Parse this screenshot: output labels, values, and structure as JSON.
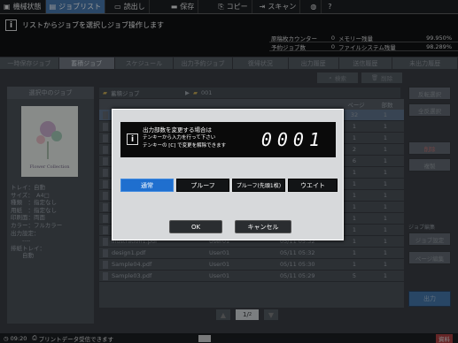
{
  "topbar": {
    "tabs": [
      {
        "label": "機械状態",
        "icon": "machine-icon"
      },
      {
        "label": "ジョブリスト",
        "icon": "job-list-icon"
      },
      {
        "label": "読出し",
        "icon": "recall-icon"
      },
      {
        "label": "保存",
        "icon": "save-icon"
      },
      {
        "label": "コピー",
        "icon": "copy-icon"
      },
      {
        "label": "スキャン",
        "icon": "scan-icon"
      }
    ]
  },
  "message": {
    "text": "リストからジョブを選択しジョブ操作します"
  },
  "counter": {
    "row1": {
      "label1": "原稿枚カウンター",
      "value1": "0",
      "label2": "メモリー残量",
      "value2": "99.950%"
    },
    "row2": {
      "label1": "予約ジョブ数",
      "value1": "0",
      "label2": "ファイルシステム残量",
      "value2": "98.289%"
    }
  },
  "tabs": [
    "一時保存ジョブ",
    "蓄積ジョブ",
    "スケジュール",
    "出力予約ジョブ",
    "復帰状況",
    "出力履歴",
    "送信履歴",
    "未出力履歴"
  ],
  "toolbar": {
    "search": "検索",
    "delete": "削除"
  },
  "left_panel": {
    "title": "選択中のジョブ",
    "thumb_text": "Flower Collection",
    "details": [
      "トレイ：自動",
      "サイズ：　A4□",
      "種類　：指定なし",
      "用紙　：指定なし",
      "印刷面：両面",
      "カラー：フルカラー",
      "出力設定：",
      "　　----",
      "排紙トレイ：",
      "　　自動"
    ]
  },
  "breadcrumb": {
    "folder": "蓄積ジョブ",
    "box": "001"
  },
  "table": {
    "headers": [
      "",
      "ページ",
      "部数"
    ],
    "rows": [
      {
        "name": "",
        "user": "",
        "date": "",
        "pages": "32",
        "copies": "1"
      },
      {
        "name": "",
        "user": "",
        "date": "",
        "pages": "1",
        "copies": "1"
      },
      {
        "name": "",
        "user": "",
        "date": "",
        "pages": "1",
        "copies": "1"
      },
      {
        "name": "",
        "user": "",
        "date": "",
        "pages": "2",
        "copies": "1"
      },
      {
        "name": "",
        "user": "",
        "date": "",
        "pages": "6",
        "copies": "1"
      },
      {
        "name": "",
        "user": "",
        "date": "",
        "pages": "1",
        "copies": "1"
      },
      {
        "name": "",
        "user": "",
        "date": "",
        "pages": "1",
        "copies": "1"
      },
      {
        "name": "",
        "user": "",
        "date": "",
        "pages": "1",
        "copies": "1"
      },
      {
        "name": "",
        "user": "",
        "date": "",
        "pages": "1",
        "copies": "1"
      },
      {
        "name": "",
        "user": "",
        "date": "",
        "pages": "1",
        "copies": "1"
      },
      {
        "name": "",
        "user": "",
        "date": "",
        "pages": "1",
        "copies": "1"
      },
      {
        "name": "illustration1.pdf",
        "user": "User01",
        "date": "05/11 05:32",
        "pages": "1",
        "copies": "1"
      },
      {
        "name": "design1.pdf",
        "user": "User01",
        "date": "05/11 05:32",
        "pages": "1",
        "copies": "1"
      },
      {
        "name": "Sample04.pdf",
        "user": "User01",
        "date": "05/11 05:30",
        "pages": "1",
        "copies": "1"
      },
      {
        "name": "Sample03.pdf",
        "user": "User01",
        "date": "05/11 05:29",
        "pages": "5",
        "copies": "1"
      }
    ]
  },
  "pager": {
    "page": "1/",
    "total": "2"
  },
  "right_panel": {
    "reverse_select": "反転選択",
    "select_all": "全反選択",
    "delete": "削除",
    "duplicate": "複製",
    "group_label": "ジョブ編集",
    "edit_job": "ジョブ設定",
    "page_edit": "ページ編集",
    "output": "出力"
  },
  "dialog": {
    "message_lines": [
      "出力部数を変更する場合は",
      "テンキーから入力を行って下さい",
      "テンキーの [C] で変更を解除できます"
    ],
    "count": "0001",
    "modes": [
      "通常",
      "プルーフ",
      "プルーフ(先頭1枚)",
      "ウエイト"
    ],
    "ok": "OK",
    "cancel": "キャンセル"
  },
  "status": {
    "time": "09:20",
    "message": "プリントデータ受信できます",
    "right_label": "資料"
  },
  "colors": {
    "accent": "#1f6fcf",
    "dialog_bg": "#d7d9db",
    "dark": "#0a0a0a"
  }
}
